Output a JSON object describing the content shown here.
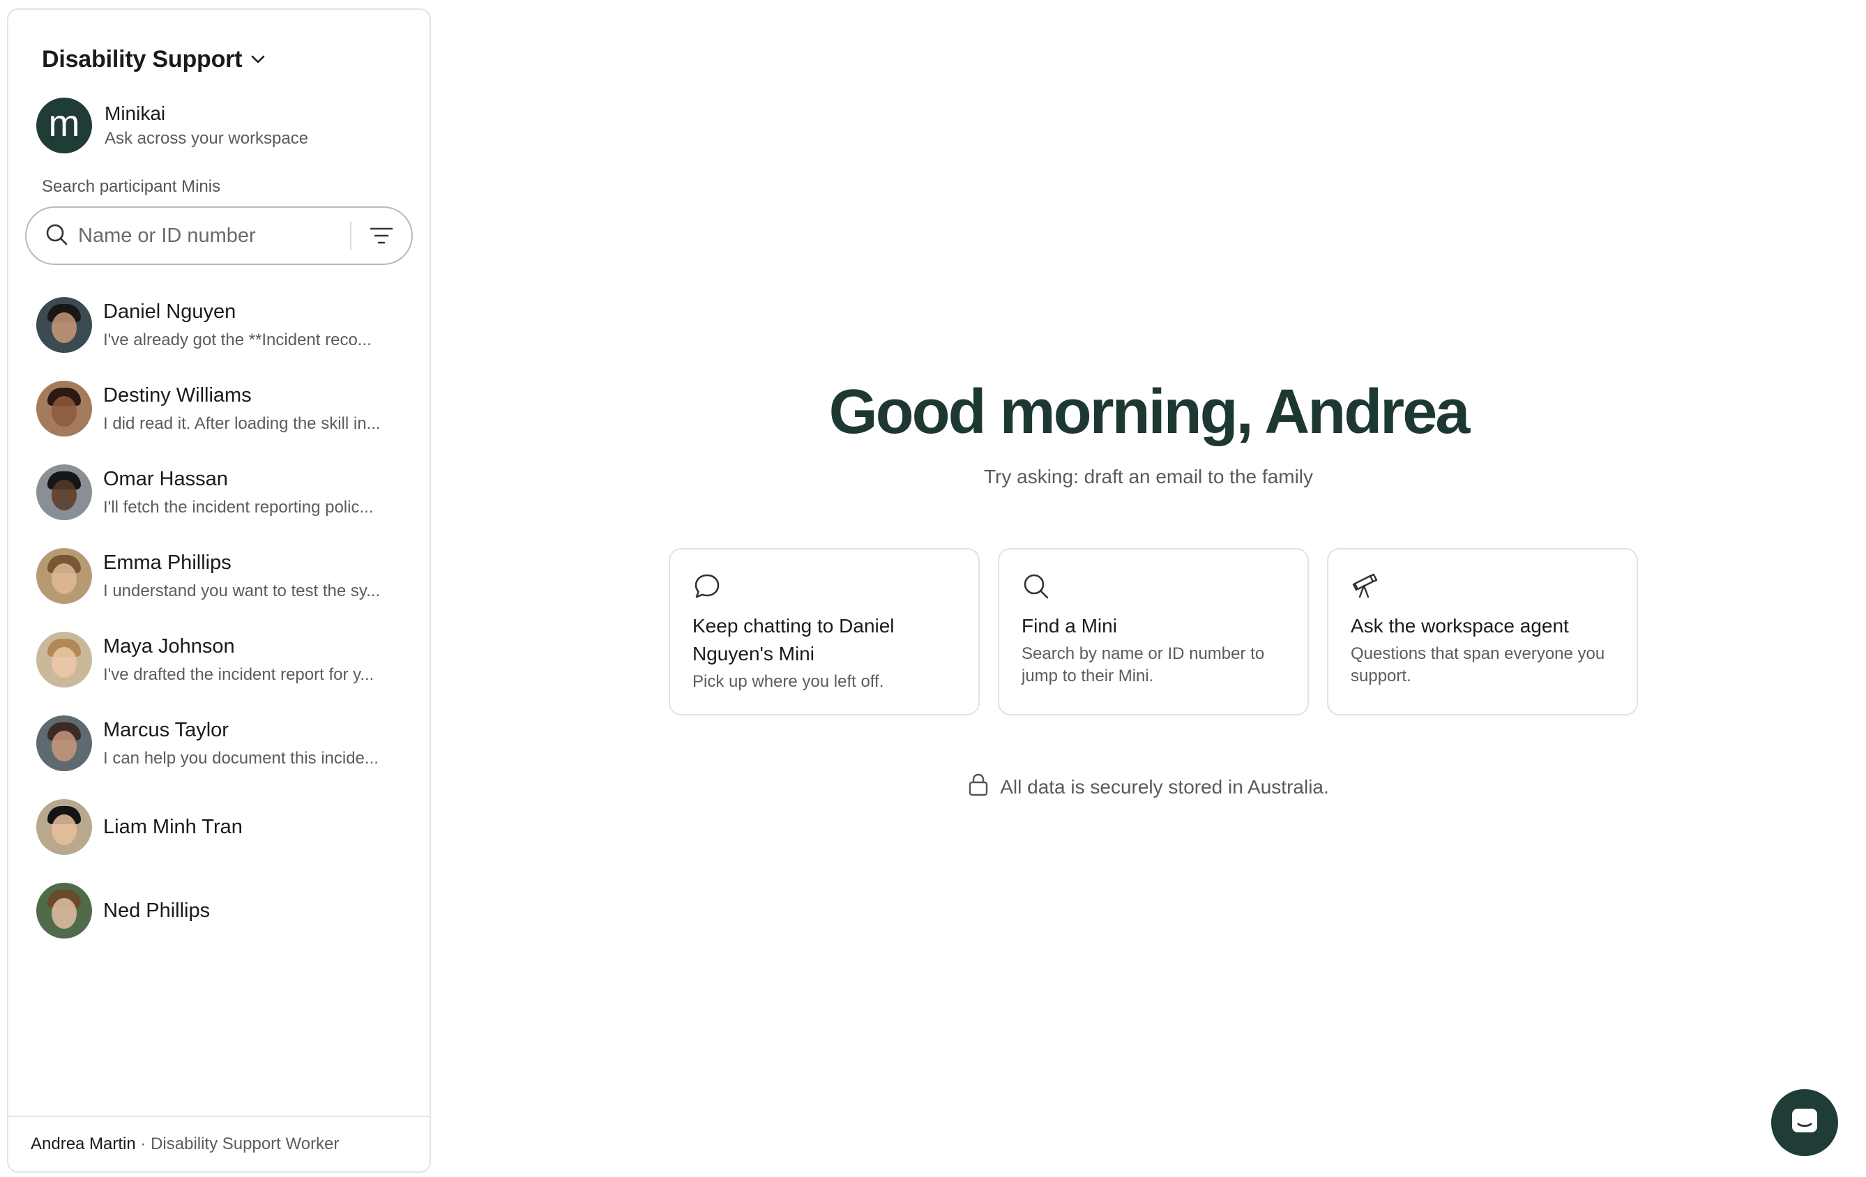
{
  "workspace": {
    "title": "Disability Support"
  },
  "minikai": {
    "avatar_letter": "m",
    "name": "Minikai",
    "subtitle": "Ask across your workspace"
  },
  "search": {
    "label": "Search participant Minis",
    "placeholder": "Name or ID number"
  },
  "contacts": [
    {
      "name": "Daniel Nguyen",
      "message": "I've already got the **Incident reco...",
      "avatar": "avatar-photo"
    },
    {
      "name": "Destiny Williams",
      "message": "I did read it. After loading the skill in...",
      "avatar": "avatar-photo"
    },
    {
      "name": "Omar Hassan",
      "message": "I'll fetch the incident reporting polic...",
      "avatar": "avatar-photo"
    },
    {
      "name": "Emma Phillips",
      "message": "I understand you want to test the sy...",
      "avatar": "avatar-photo"
    },
    {
      "name": "Maya Johnson",
      "message": "I've drafted the incident report for y...",
      "avatar": "avatar-photo"
    },
    {
      "name": "Marcus Taylor",
      "message": "I can help you document this incide...",
      "avatar": "avatar-photo"
    },
    {
      "name": "Liam Minh Tran",
      "message": "",
      "avatar": "avatar-photo"
    },
    {
      "name": "Ned Phillips",
      "message": "",
      "avatar": "avatar-photo"
    }
  ],
  "user": {
    "name": "Andrea Martin",
    "separator": " · ",
    "role": "Disability Support Worker"
  },
  "main": {
    "greeting": "Good morning, Andrea",
    "suggestion": "Try asking: draft an email to the family",
    "cards": [
      {
        "icon": "chat-bubble-icon",
        "title": "Keep chatting to Daniel Nguyen's Mini",
        "description": "Pick up where you left off."
      },
      {
        "icon": "search-icon",
        "title": "Find a Mini",
        "description": "Search by name or ID number to jump to their Mini."
      },
      {
        "icon": "telescope-icon",
        "title": "Ask the workspace agent",
        "description": "Questions that span everyone you support."
      }
    ],
    "security_note": "All data is securely stored in Australia."
  },
  "colors": {
    "brand": "#1f3d36",
    "greeting": "#1d3832",
    "muted_text": "#5c5c5c",
    "border": "#e2e2e2"
  }
}
